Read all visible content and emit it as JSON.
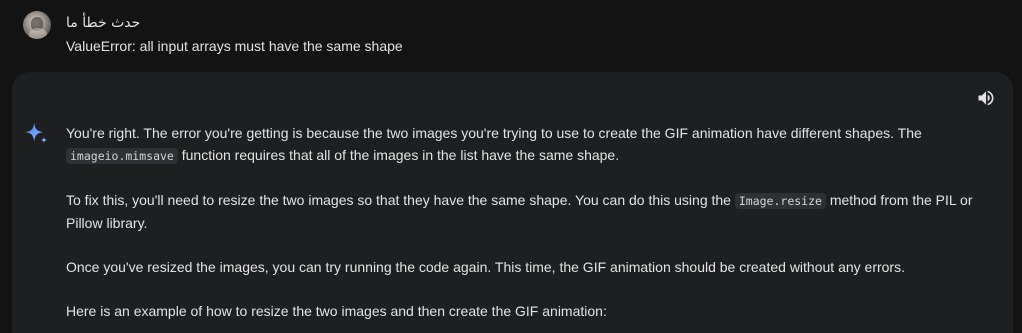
{
  "user": {
    "title": "حدث خطأ ما",
    "message": "ValueError: all input arrays must have the same shape"
  },
  "response": {
    "icons": {
      "assistant": "sparkle-icon",
      "read_aloud": "speaker-icon"
    },
    "p1": {
      "t1": "You're right. The error you're getting is because the two images you're trying to use to create the GIF animation have different shapes. The ",
      "code1": "imageio.mimsave",
      "t2": " function requires that all of the images in the list have the same shape."
    },
    "p2": {
      "t1": "To fix this, you'll need to resize the two images so that they have the same shape. You can do this using the ",
      "code1": "Image.resize",
      "t2": " method from the PIL or Pillow library."
    },
    "p3": "Once you've resized the images, you can try running the code again. This time, the GIF animation should be created without any errors.",
    "p4": "Here is an example of how to resize the two images and then create the GIF animation:"
  },
  "colors": {
    "background": "#131314",
    "card": "#1e1f20",
    "text": "#e3e3e3",
    "sparkle_blue": "#4285f4"
  }
}
